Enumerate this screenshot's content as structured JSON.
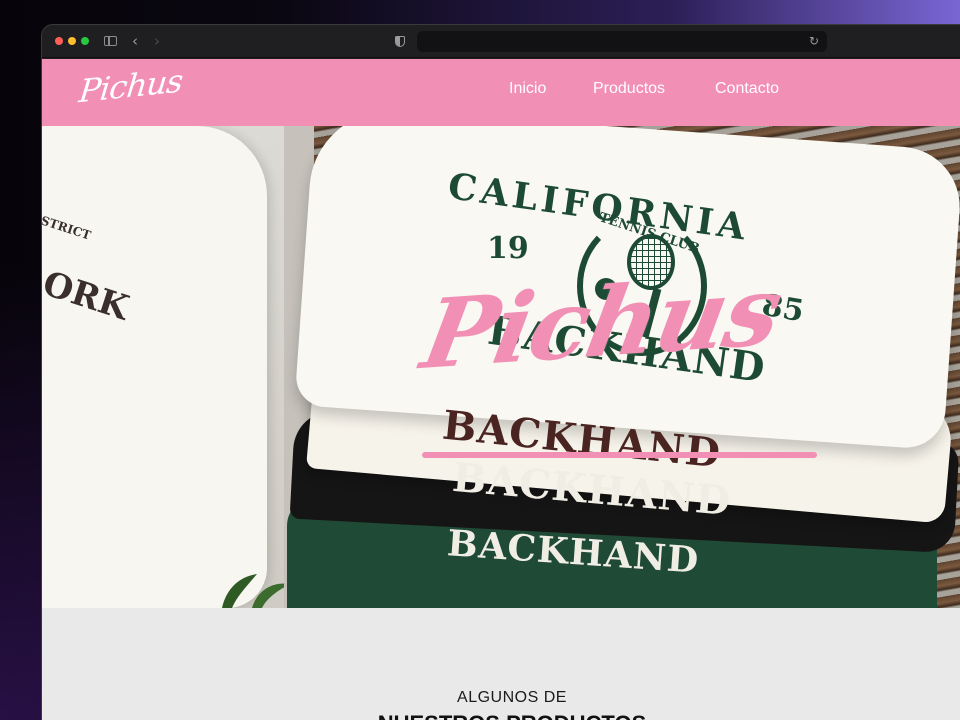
{
  "browser": {
    "url": "",
    "back_icon": "chevron-left-icon",
    "forward_icon": "chevron-right-icon",
    "reload_icon": "reload-icon"
  },
  "site": {
    "logo": "Pichus",
    "nav": [
      {
        "label": "Inicio"
      },
      {
        "label": "Productos"
      },
      {
        "label": "Contacto"
      }
    ],
    "brand_color": "#f28fb5"
  },
  "hero": {
    "title": "Pichus",
    "image_text": {
      "california": "CALIFORNIA",
      "year_left": "19",
      "year_right": "85",
      "club": "TENNIS CLUB",
      "backhand": "BACKHAND",
      "district": "STRICT",
      "york": "ORK"
    }
  },
  "products_section": {
    "subtitle": "ALGUNOS DE",
    "title": "NUESTROS PRODUCTOS"
  }
}
